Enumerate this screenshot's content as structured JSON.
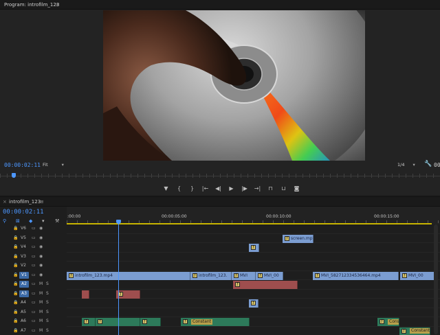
{
  "monitor": {
    "title": "Program: introfilm_123",
    "menu_icon": "≡",
    "timecode": "00:00:02:11",
    "fit_label": "Fit",
    "quality_label": "1/4",
    "duration_partial": "00",
    "transport": [
      {
        "name": "add-marker-icon",
        "glyph": "▼"
      },
      {
        "name": "mark-in-icon",
        "glyph": "{"
      },
      {
        "name": "mark-out-icon",
        "glyph": "}"
      },
      {
        "name": "go-to-in-icon",
        "glyph": "|←"
      },
      {
        "name": "step-back-icon",
        "glyph": "◀|"
      },
      {
        "name": "play-icon",
        "glyph": "▶"
      },
      {
        "name": "step-forward-icon",
        "glyph": "|▶"
      },
      {
        "name": "go-to-out-icon",
        "glyph": "→|"
      },
      {
        "name": "lift-icon",
        "glyph": "⊓"
      },
      {
        "name": "extract-icon",
        "glyph": "⊔"
      },
      {
        "name": "export-frame-icon",
        "glyph": "◙"
      }
    ]
  },
  "timeline": {
    "close_icon": "×",
    "title": "introfilm_123",
    "menu_icon": "≡",
    "timecode": "00:00:02:11",
    "ruler": [
      ":00:00",
      "00:00:05:00",
      "00:00:10:00",
      "00:00:15:00"
    ],
    "tools": [
      {
        "name": "snap-icon",
        "glyph": "⚲"
      },
      {
        "name": "linked-selection-icon",
        "glyph": "⊠"
      },
      {
        "name": "add-marker-icon",
        "glyph": "◆"
      },
      {
        "name": "settings-icon",
        "glyph": "▾"
      },
      {
        "name": "wrench-icon",
        "glyph": "⚒"
      }
    ],
    "video_tracks": [
      "V6",
      "V5",
      "V4",
      "V3",
      "V2",
      "V1"
    ],
    "audio_tracks": [
      "A2",
      "A3",
      "A4",
      "A5",
      "A6",
      "A7"
    ],
    "mute_label": "M",
    "solo_label": "S",
    "clips": {
      "screen": "screen.mp",
      "intro": "introfilm_123.mp4",
      "intro2": "introfilm_123.",
      "mvi_a": "MVI",
      "mvi_b": "MVI_00",
      "mvi_long": "MVI_582712334536464.mp4",
      "mvi_c": "MVI_00",
      "constant1": "Constant",
      "constant2": "Constant",
      "constant3": "Constant"
    }
  },
  "colors": {
    "accent": "#4d97ff",
    "video_clip": "#7b9dd1",
    "audio_red": "#9e4e4e",
    "audio_green": "#2d7a5a",
    "work_area": "#c8b400"
  }
}
